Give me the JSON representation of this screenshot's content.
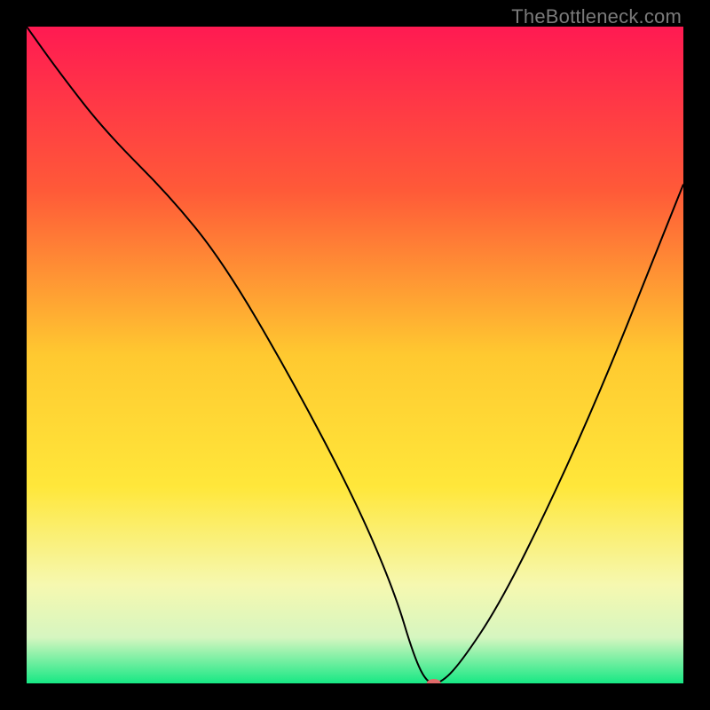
{
  "attribution": "TheBottleneck.com",
  "chart_data": {
    "type": "line",
    "title": "",
    "xlabel": "",
    "ylabel": "",
    "xlim": [
      0,
      100
    ],
    "ylim": [
      0,
      100
    ],
    "gradient_stops": [
      {
        "offset": 0,
        "color": "#ff1a52"
      },
      {
        "offset": 0.25,
        "color": "#ff5a38"
      },
      {
        "offset": 0.5,
        "color": "#ffc930"
      },
      {
        "offset": 0.7,
        "color": "#ffe73a"
      },
      {
        "offset": 0.85,
        "color": "#f6f8b0"
      },
      {
        "offset": 0.93,
        "color": "#d6f6c0"
      },
      {
        "offset": 1.0,
        "color": "#17e884"
      }
    ],
    "curve": {
      "x": [
        0,
        5,
        12,
        22,
        30,
        40,
        50,
        56,
        59,
        61,
        63,
        66,
        72,
        80,
        88,
        96,
        100
      ],
      "y": [
        100,
        93,
        84,
        74,
        64,
        47,
        28,
        14,
        4,
        0,
        0,
        3,
        12,
        28,
        46,
        66,
        76
      ]
    },
    "curve_style": {
      "stroke": "#000000",
      "width": 2
    },
    "marker": {
      "x": 62,
      "y": 0,
      "rx": 8,
      "ry": 5,
      "fill": "#e06a6a"
    }
  }
}
